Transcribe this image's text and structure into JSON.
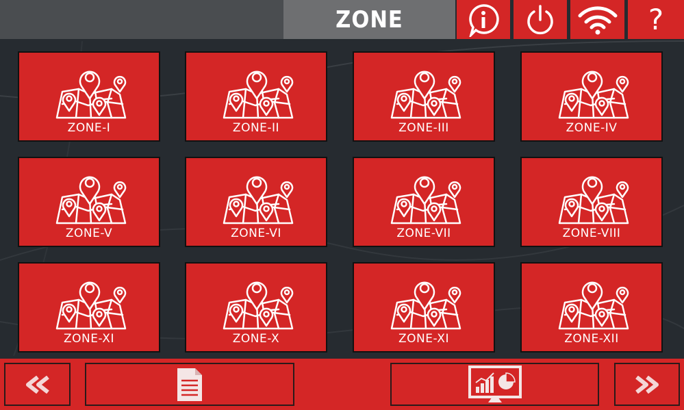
{
  "header": {
    "title": "ZONE",
    "help_label": "?"
  },
  "zones": [
    {
      "label": "ZONE-I"
    },
    {
      "label": "ZONE-II"
    },
    {
      "label": "ZONE-III"
    },
    {
      "label": "ZONE-IV"
    },
    {
      "label": "ZONE-V"
    },
    {
      "label": "ZONE-VI"
    },
    {
      "label": "ZONE-VII"
    },
    {
      "label": "ZONE-VIII"
    },
    {
      "label": "ZONE-XI"
    },
    {
      "label": "ZONE-X"
    },
    {
      "label": "ZONE-XI"
    },
    {
      "label": "ZONE-XII"
    }
  ],
  "icons": {
    "info": "info-icon",
    "power": "power-icon",
    "wifi": "wifi-icon",
    "help": "help-icon",
    "zone_map": "map-pins-icon",
    "prev": "double-chevron-left-icon",
    "report": "document-icon",
    "dashboard": "chart-monitor-icon",
    "next": "double-chevron-right-icon"
  },
  "colors": {
    "accent": "#d42626",
    "background": "#262b30",
    "title_bg": "#6e6f71",
    "top_left_bg": "#4a4d50"
  }
}
